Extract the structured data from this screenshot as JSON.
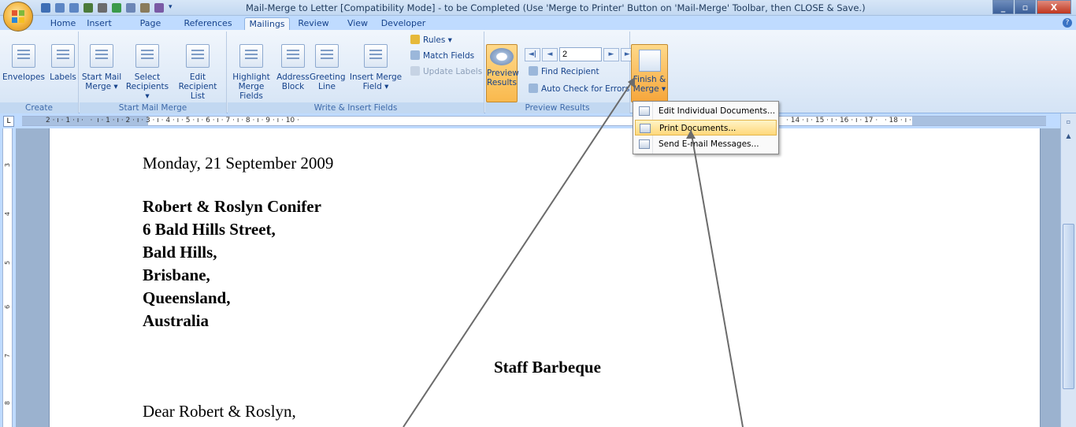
{
  "window": {
    "title": "Mail-Merge to Letter [Compatibility Mode] - to be Completed (Use 'Merge to Printer' Button on 'Mail-Merge' Toolbar, then CLOSE & Save.)",
    "controls": {
      "minimize": "_",
      "maximize": "▫",
      "close": "X"
    }
  },
  "tabs": [
    "Home",
    "Insert",
    "Page Layout",
    "References",
    "Mailings",
    "Review",
    "View",
    "Developer"
  ],
  "active_tab": "Mailings",
  "help": "?",
  "ribbon": {
    "create": {
      "label": "Create",
      "envelopes": "Envelopes",
      "labels": "Labels"
    },
    "start_mail_merge": {
      "label": "Start Mail Merge",
      "start": [
        "Start Mail",
        "Merge ▾"
      ],
      "select": [
        "Select",
        "Recipients ▾"
      ],
      "edit": [
        "Edit",
        "Recipient List"
      ]
    },
    "write_insert": {
      "label": "Write & Insert Fields",
      "highlight": [
        "Highlight",
        "Merge Fields"
      ],
      "address": [
        "Address",
        "Block"
      ],
      "greeting": [
        "Greeting",
        "Line"
      ],
      "insert_merge": [
        "Insert Merge",
        "Field ▾"
      ],
      "rules": "Rules ▾",
      "match_fields": "Match Fields",
      "update_labels": "Update Labels"
    },
    "preview": {
      "label": "Preview Results",
      "preview_btn": [
        "Preview",
        "Results"
      ],
      "record": "2",
      "find_recipient": "Find Recipient",
      "auto_check": "Auto Check for Errors",
      "nav": {
        "first": "◄|",
        "prev": "◄",
        "next": "►",
        "last": "►|"
      }
    },
    "finish": {
      "button": [
        "Finish &",
        "Merge ▾"
      ]
    }
  },
  "menu": {
    "items": [
      "Edit Individual Documents...",
      "Print Documents...",
      "Send E-mail Messages..."
    ],
    "highlighted": 1
  },
  "ruler": {
    "tab_glyph": "L",
    "marks": "2 · ı · 1 · ı ·   ·  ı · 1 · ı · 2 · ı · 3 · ı · 4 · ı · 5 · ı · 6 · ı · 7 · ı · 8 · ı · 9 · ı · 10 ·",
    "marks_right": "· 14 · ı · 15 · ı · 16 · ı · 17 ·   · 18 · ı ·"
  },
  "vruler": [
    "3",
    "4",
    "5",
    "6",
    "7",
    "8"
  ],
  "document": {
    "date": "Monday, 21 September 2009",
    "address": [
      "Robert & Roslyn Conifer",
      "6 Bald Hills Street,",
      "Bald Hills,",
      "Brisbane,",
      "Queensland,",
      "Australia"
    ],
    "subject": "Staff Barbeque",
    "salutation": "Dear Robert & Roslyn,"
  },
  "colors": {
    "ribbon_text": "#15428b",
    "highlight": "#ffd87b",
    "office_orange": "#f3b43c"
  }
}
